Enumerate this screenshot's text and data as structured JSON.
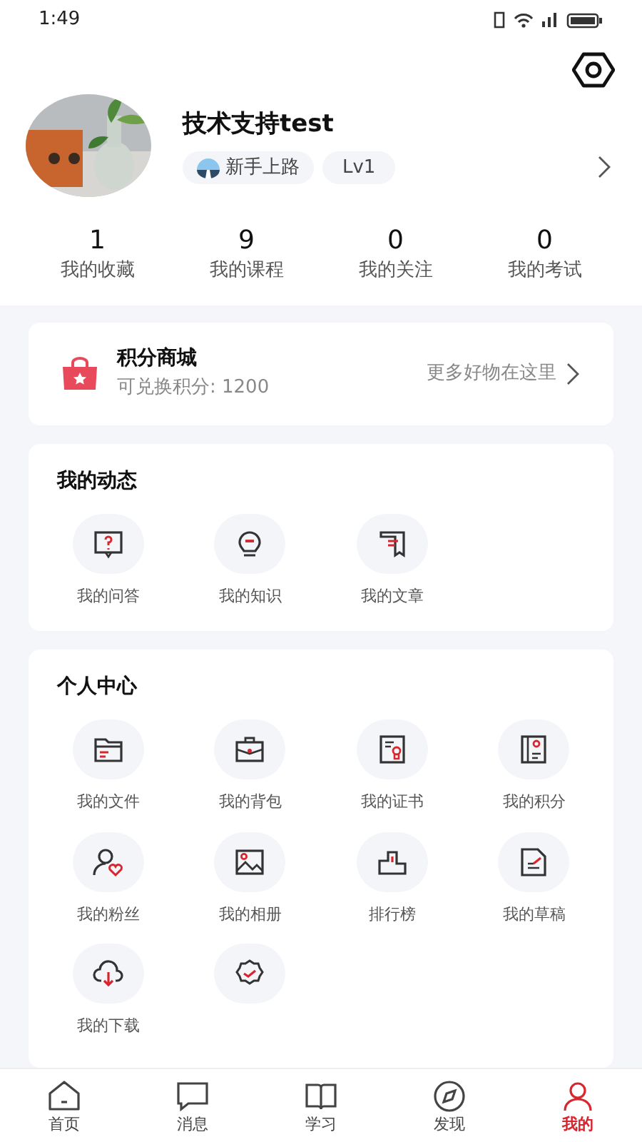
{
  "status_bar": {
    "time": "1:49"
  },
  "profile": {
    "name": "技术支持test",
    "badge": "新手上路",
    "level": "Lv1"
  },
  "stats": [
    {
      "value": "1",
      "label": "我的收藏"
    },
    {
      "value": "9",
      "label": "我的课程"
    },
    {
      "value": "0",
      "label": "我的关注"
    },
    {
      "value": "0",
      "label": "我的考试"
    }
  ],
  "points_mall": {
    "title": "积分商城",
    "subtitle": "可兑换积分: 1200",
    "link": "更多好物在这里"
  },
  "my_activity": {
    "title": "我的动态",
    "items": [
      {
        "label": "我的问答"
      },
      {
        "label": "我的知识"
      },
      {
        "label": "我的文章"
      }
    ]
  },
  "personal_center": {
    "title": "个人中心",
    "items": [
      {
        "label": "我的文件"
      },
      {
        "label": "我的背包"
      },
      {
        "label": "我的证书"
      },
      {
        "label": "我的积分"
      },
      {
        "label": "我的粉丝"
      },
      {
        "label": "我的相册"
      },
      {
        "label": "排行榜"
      },
      {
        "label": "我的草稿"
      },
      {
        "label": "我的下载"
      },
      {
        "kind": "icon"
      }
    ]
  },
  "tab_bar": [
    {
      "label": "首页",
      "selected": false
    },
    {
      "label": "消息",
      "selected": false
    },
    {
      "label": "学习",
      "selected": false
    },
    {
      "label": "发现",
      "selected": false
    },
    {
      "label": "我的",
      "selected": true
    }
  ]
}
